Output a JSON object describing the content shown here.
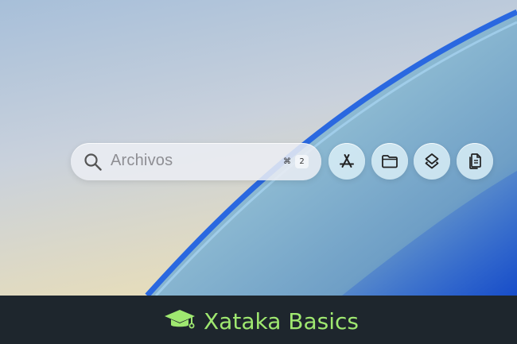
{
  "search": {
    "placeholder": "Archivos",
    "shortcut_modifier": "⌘",
    "shortcut_key": "2"
  },
  "quick_actions": [
    {
      "name": "app-store-icon"
    },
    {
      "name": "folder-icon"
    },
    {
      "name": "layers-icon"
    },
    {
      "name": "documents-icon"
    }
  ],
  "footer": {
    "brand": "Xataka Basics",
    "brand_color": "#9fe870",
    "background_color": "#1e262d"
  }
}
